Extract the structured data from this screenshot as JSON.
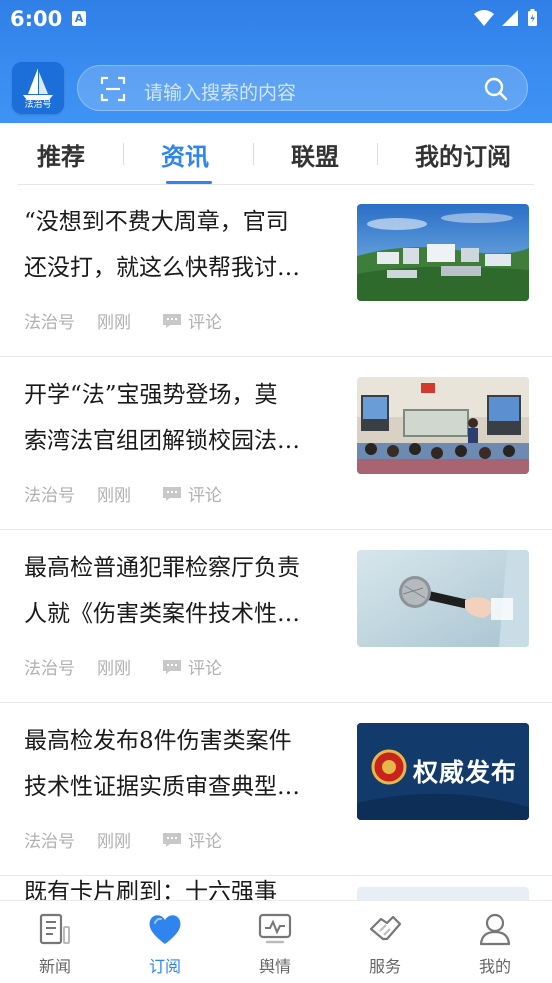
{
  "status_bar": {
    "time": "6:00",
    "notification_letter": "A"
  },
  "app": {
    "logo_text": "法治号"
  },
  "search": {
    "placeholder": "请输入搜索的内容"
  },
  "tabs": [
    {
      "label": "推荐",
      "active": false
    },
    {
      "label": "资讯",
      "active": true
    },
    {
      "label": "联盟",
      "active": false
    },
    {
      "label": "我的订阅",
      "active": false
    }
  ],
  "articles": [
    {
      "title_lines": [
        "“没想到不费大周章，官司",
        "还没打，就这么快帮我讨…"
      ],
      "source": "法治号",
      "time": "刚刚",
      "comment_label": "评论",
      "thumb": "aerial-campus-photo"
    },
    {
      "title_lines": [
        "开学“法”宝强势登场，莫",
        "索湾法官组团解锁校园法…"
      ],
      "source": "法治号",
      "time": "刚刚",
      "comment_label": "评论",
      "thumb": "classroom-photo"
    },
    {
      "title_lines": [
        "最高检普通犯罪检察厅负责",
        "人就《伤害类案件技术性…"
      ],
      "source": "法治号",
      "time": "刚刚",
      "comment_label": "评论",
      "thumb": "microphone-photo"
    },
    {
      "title_lines": [
        "最高检发布8件伤害类案件",
        "技术性证据实质审查典型…"
      ],
      "source": "法治号",
      "time": "刚刚",
      "comment_label": "评论",
      "thumb": "authority-release-banner",
      "thumb_text": "权威发布"
    }
  ],
  "partial_article": {
    "title_partial": "既有卡片刷到：十六强事"
  },
  "bottom_nav": [
    {
      "label": "新闻",
      "icon": "news-icon",
      "active": false
    },
    {
      "label": "订阅",
      "icon": "heart-icon",
      "active": true
    },
    {
      "label": "舆情",
      "icon": "monitor-icon",
      "active": false
    },
    {
      "label": "服务",
      "icon": "service-icon",
      "active": false
    },
    {
      "label": "我的",
      "icon": "profile-icon",
      "active": false
    }
  ],
  "colors": {
    "header": "#3a8cf0",
    "accent": "#2f84ee",
    "meta_text": "#b0b0b0"
  }
}
